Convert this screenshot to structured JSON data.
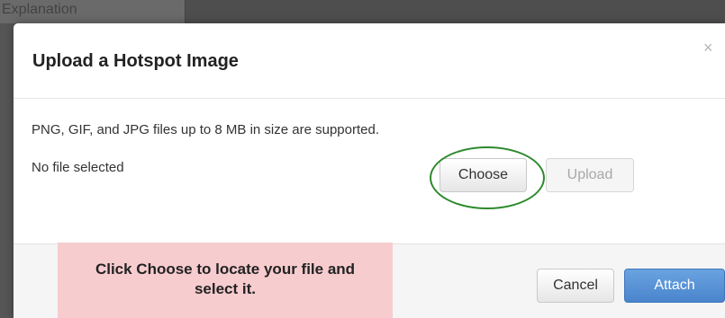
{
  "background": {
    "sidebar_label": "Explanation"
  },
  "dialog": {
    "title": "Upload a Hotspot Image",
    "close_glyph": "×",
    "supported_text": "PNG, GIF, and JPG files up to 8 MB in size are supported.",
    "file_status": "No file selected",
    "choose_label": "Choose",
    "upload_label": "Upload",
    "cancel_label": "Cancel",
    "attach_label": "Attach"
  },
  "annotation": {
    "text": "Click Choose to locate your file and select it.",
    "highlight_color": "#2d8a2d",
    "callout_color": "#f7cccf"
  },
  "colors": {
    "primary_button": "#4a84cc",
    "overlay": "#555555"
  }
}
